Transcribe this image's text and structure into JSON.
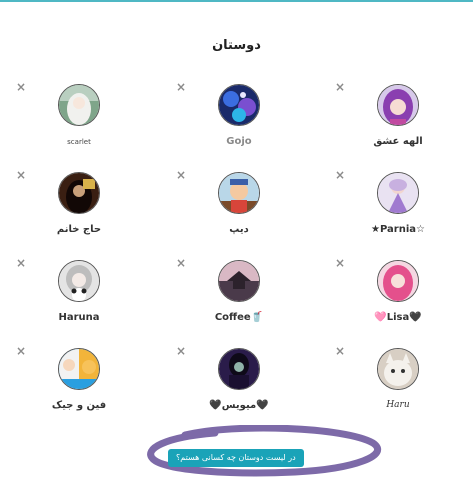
{
  "page_title": "دوستان",
  "remove_icon": "×",
  "friends": [
    {
      "name": "scarlet",
      "icon": "avatar-white-hair-girl"
    },
    {
      "name": "Gojo",
      "icon": "avatar-blue-anime"
    },
    {
      "name": "الهه عشق",
      "icon": "avatar-purple-hair-girl"
    },
    {
      "name": "حاج خانم",
      "icon": "avatar-dark-haired-woman"
    },
    {
      "name": "دیپ",
      "icon": "avatar-cartoon-boy"
    },
    {
      "name": "★Parnia☆",
      "icon": "avatar-purple-dress-girl"
    },
    {
      "name": "Haruna",
      "icon": "avatar-panda-girl"
    },
    {
      "name": "Coffee🥤",
      "icon": "avatar-night-city"
    },
    {
      "name": "🩷Lisa🖤",
      "icon": "avatar-pink-hair-girl"
    },
    {
      "name": "فین و جیک",
      "icon": "avatar-finn-and-jake"
    },
    {
      "name": "🖤میویس🖤",
      "icon": "avatar-vampire-girl"
    },
    {
      "name": "Haru",
      "icon": "avatar-white-kitten"
    }
  ],
  "who_button_label": "در لیست دوستان چه کسانی هستم؟",
  "colors": {
    "accent": "#1aa3b8",
    "top_line": "#4fb8c4",
    "scribble": "#7d6aa8"
  }
}
